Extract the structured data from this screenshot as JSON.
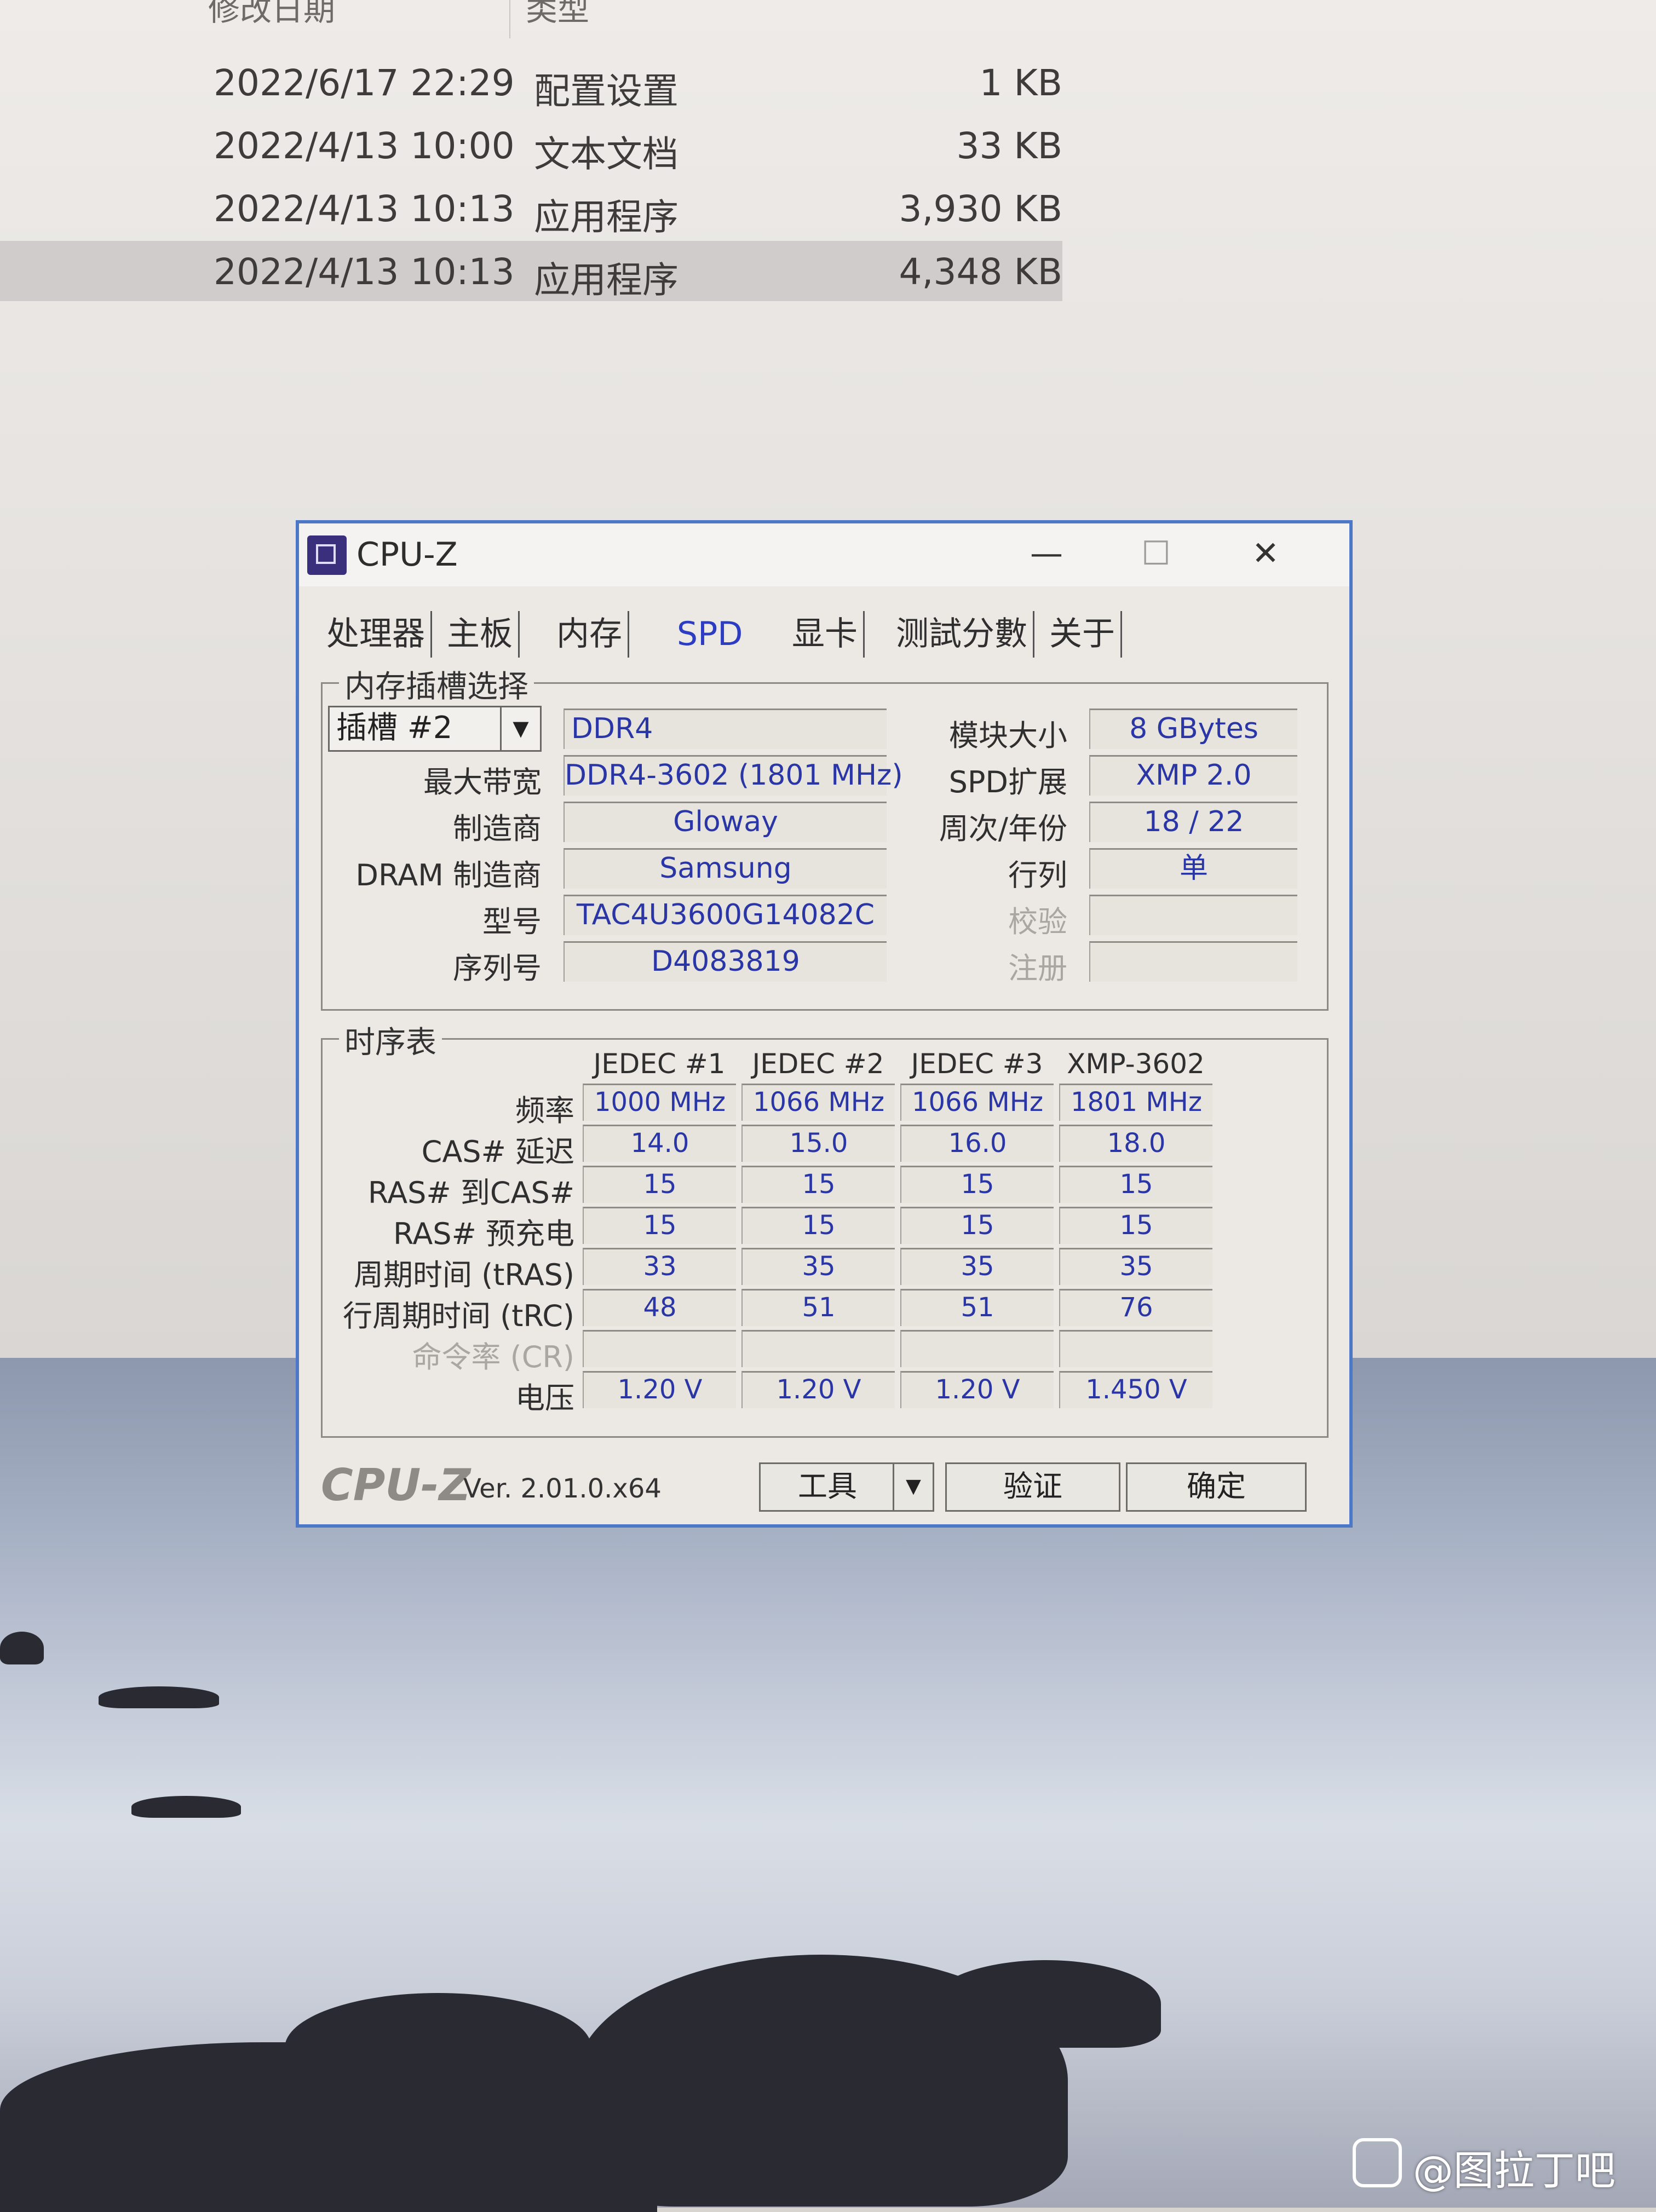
{
  "explorer": {
    "col_date": "修改日期",
    "col_type": "类型",
    "rows": [
      {
        "date": "2022/6/17 22:29",
        "type": "配置设置",
        "size": "1 KB"
      },
      {
        "date": "2022/4/13 10:00",
        "type": "文本文档",
        "size": "33 KB"
      },
      {
        "date": "2022/4/13 10:13",
        "type": "应用程序",
        "size": "3,930 KB"
      },
      {
        "date": "2022/4/13 10:13",
        "type": "应用程序",
        "size": "4,348 KB"
      }
    ]
  },
  "window": {
    "title": "CPU-Z",
    "minimize": "—",
    "maximize": "☐",
    "close": "✕"
  },
  "tabs": [
    "处理器",
    "主板",
    "内存",
    "SPD",
    "显卡",
    "测試分數",
    "关于"
  ],
  "slot_panel": {
    "title": "内存插槽选择",
    "slot_select": "插槽 #2",
    "type": "DDR4",
    "max_bandwidth_label": "最大带宽",
    "max_bandwidth": "DDR4-3602 (1801 MHz)",
    "manufacturer_label": "制造商",
    "manufacturer": "Gloway",
    "dram_mfr_label": "DRAM 制造商",
    "dram_mfr": "Samsung",
    "part_label": "型号",
    "part": "TAC4U3600G14082C",
    "serial_label": "序列号",
    "serial": "D4083819",
    "module_size_label": "模块大小",
    "module_size": "8 GBytes",
    "spd_ext_label": "SPD扩展",
    "spd_ext": "XMP 2.0",
    "week_year_label": "周次/年份",
    "week_year": "18 / 22",
    "ranks_label": "行列",
    "ranks": "单",
    "correction_label": "校验",
    "correction": "",
    "registered_label": "注册",
    "registered": ""
  },
  "timing": {
    "title": "时序表",
    "columns": [
      "JEDEC #1",
      "JEDEC #2",
      "JEDEC #3",
      "XMP-3602"
    ],
    "rows": [
      {
        "label": "频率",
        "values": [
          "1000 MHz",
          "1066 MHz",
          "1066 MHz",
          "1801 MHz"
        ]
      },
      {
        "label": "CAS# 延迟",
        "values": [
          "14.0",
          "15.0",
          "16.0",
          "18.0"
        ]
      },
      {
        "label": "RAS# 到CAS#",
        "values": [
          "15",
          "15",
          "15",
          "15"
        ]
      },
      {
        "label": "RAS# 预充电",
        "values": [
          "15",
          "15",
          "15",
          "15"
        ]
      },
      {
        "label": "周期时间 (tRAS)",
        "values": [
          "33",
          "35",
          "35",
          "35"
        ]
      },
      {
        "label": "行周期时间 (tRC)",
        "values": [
          "48",
          "51",
          "51",
          "76"
        ]
      },
      {
        "label": "命令率 (CR)",
        "values": [
          "",
          "",
          "",
          ""
        ]
      },
      {
        "label": "电压",
        "values": [
          "1.20 V",
          "1.20 V",
          "1.20 V",
          "1.450 V"
        ]
      }
    ]
  },
  "footer": {
    "logo": "CPU-Z",
    "version": "Ver. 2.01.0.x64",
    "tools": "工具",
    "validate": "验证",
    "ok": "确定"
  },
  "watermark": "@图拉丁吧"
}
